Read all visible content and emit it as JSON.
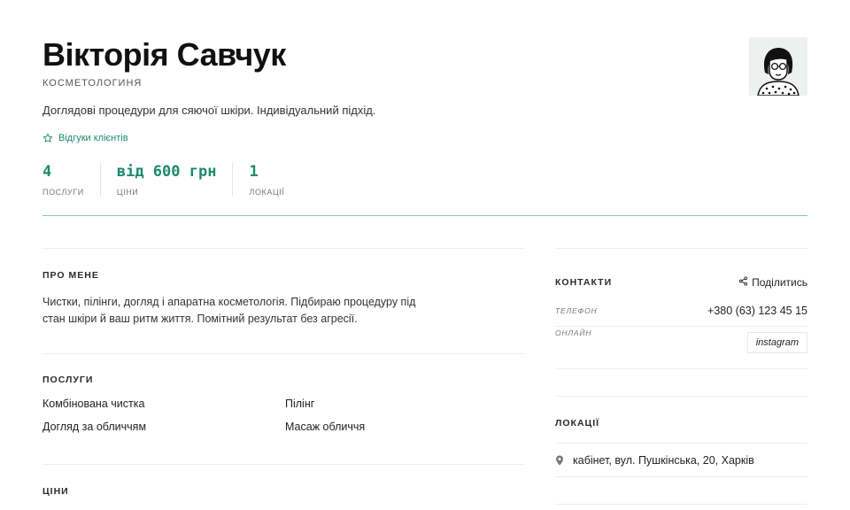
{
  "profile": {
    "name": "Вікторія Савчук",
    "profession": "КОСМЕТОЛОГИНЯ",
    "tagline": "Доглядові процедури для сяючої шкіри. Індивідуальний підхід.",
    "reviews_label": "Відгуки клієнтів"
  },
  "stats": [
    {
      "value": "4",
      "label": "ПОСЛУГИ"
    },
    {
      "value": "від 600 грн",
      "label": "ЦІНИ"
    },
    {
      "value": "1",
      "label": "ЛОКАЦІЇ"
    }
  ],
  "about": {
    "title": "ПРО МЕНЕ",
    "text": "Чистки, пілінги, догляд і апаратна косметологія. Підбираю процедуру під стан шкіри й ваш ритм життя. Помітний результат без агресії."
  },
  "services": {
    "title": "ПОСЛУГИ",
    "items": [
      "Комбінована чистка",
      "Пілінг",
      "Догляд за обличчям",
      "Масаж обличчя"
    ]
  },
  "prices": {
    "title": "ЦІНИ"
  },
  "contacts": {
    "title": "КОНТАКТИ",
    "share_label": "Поділитись",
    "phone_label": "ТЕЛЕФОН",
    "phone_value": "+380 (63) 123 45 15",
    "online_label": "ОНЛАЙН",
    "instagram_label": "instagram"
  },
  "locations": {
    "title": "ЛОКАЦІЇ",
    "items": [
      "кабінет, вул. Пушкінська, 20, Харків"
    ]
  },
  "colors": {
    "accent": "#1b8a6b",
    "divider": "#7fc9c1"
  },
  "icons": [
    "star-icon",
    "share-icon",
    "location-pin-icon",
    "avatar-illustration"
  ]
}
